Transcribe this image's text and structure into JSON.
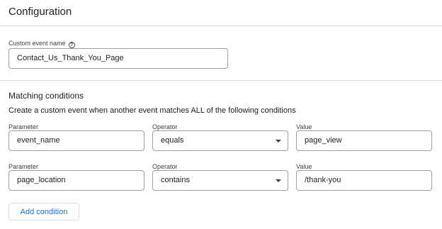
{
  "header": {
    "title": "Configuration"
  },
  "custom_event": {
    "label": "Custom event name",
    "help_icon": "help-circle-icon",
    "value": "Contact_Us_Thank_You_Page"
  },
  "matching": {
    "title": "Matching conditions",
    "description": "Create a custom event when another event matches ALL of the following conditions",
    "conditions": [
      {
        "parameter_label": "Parameter",
        "parameter": "event_name",
        "operator_label": "Operator",
        "operator": "equals",
        "value_label": "Value",
        "value": "page_view"
      },
      {
        "parameter_label": "Parameter",
        "parameter": "page_location",
        "operator_label": "Operator",
        "operator": "contains",
        "value_label": "Value",
        "value": "/thank-you"
      }
    ],
    "add_condition_label": "Add condition"
  },
  "colors": {
    "accent": "#1a73e8",
    "border": "#9aa0a6",
    "divider": "#dadce0"
  }
}
